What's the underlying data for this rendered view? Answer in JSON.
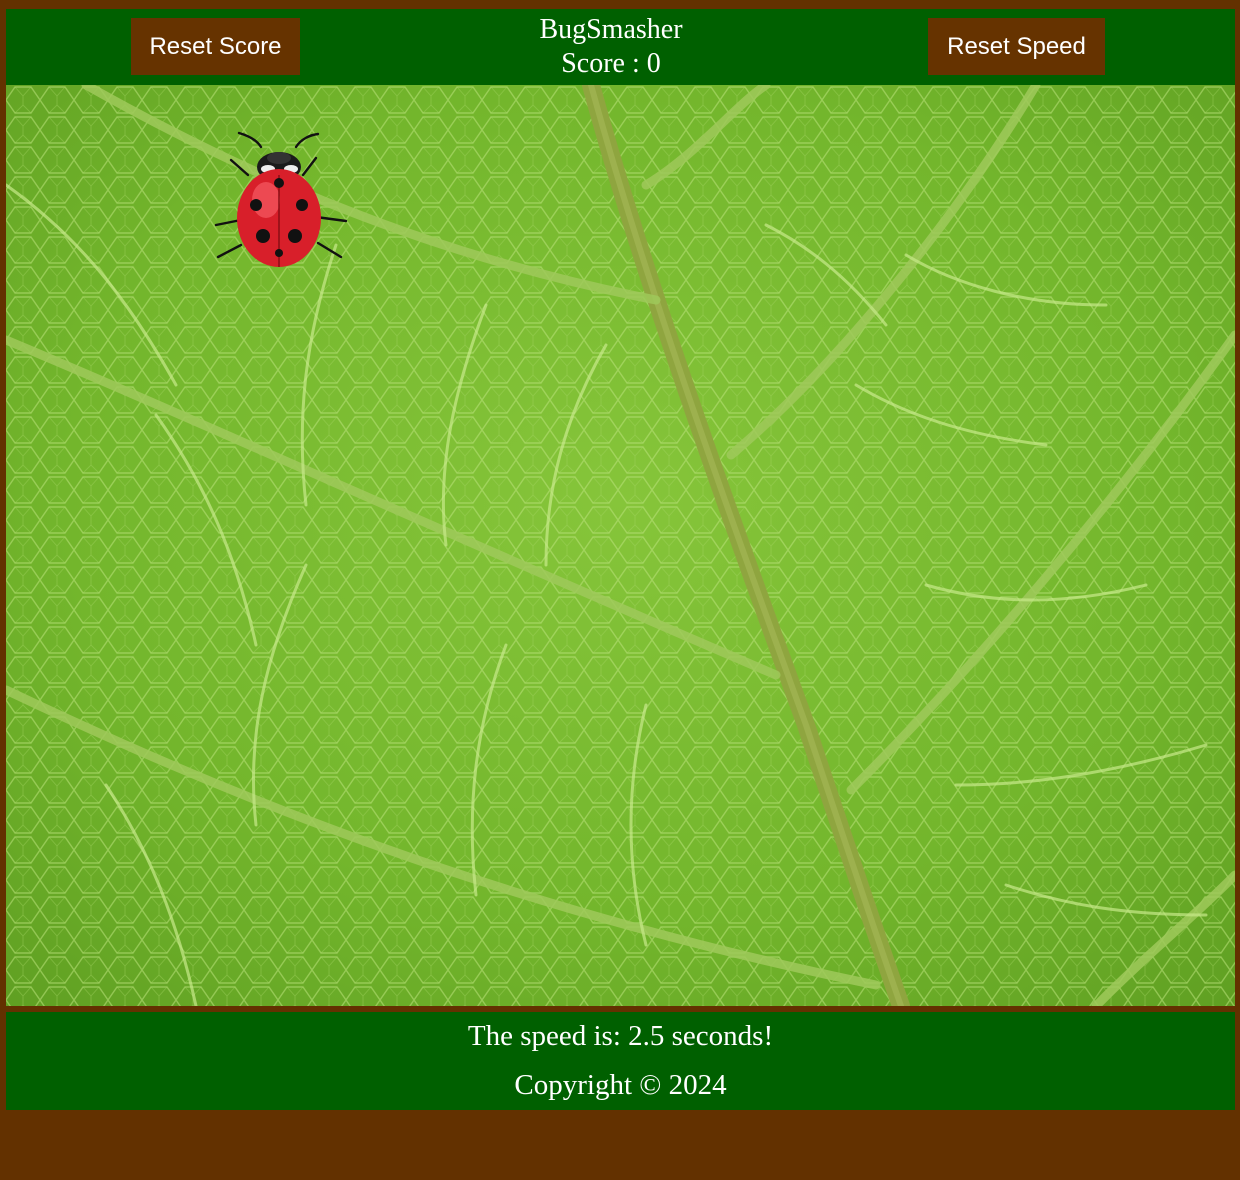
{
  "header": {
    "reset_score_label": "Reset Score",
    "title": "BugSmasher",
    "score_text": "Score : 0",
    "reset_speed_label": "Reset Speed"
  },
  "game": {
    "bug_icon": "ladybug-icon",
    "background": "green-leaf-texture"
  },
  "footer": {
    "speed_text": "The speed is: 2.5 seconds!",
    "copyright_text": "Copyright © 2024"
  },
  "colors": {
    "page_background": "#633100",
    "bar_green": "#006000",
    "button_brown": "#663300",
    "text": "#ffffff"
  }
}
